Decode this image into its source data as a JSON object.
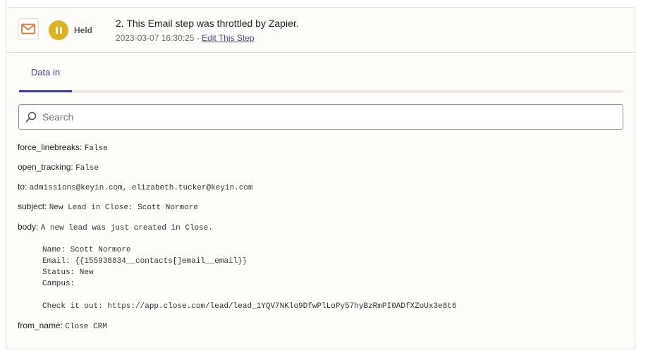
{
  "step": {
    "status_label": "Held",
    "title": "2. This Email step was throttled by Zapier.",
    "timestamp": "2023-03-07 16:30:25",
    "separator": " - ",
    "edit_link": "Edit This Step",
    "app_icon": "envelope-icon",
    "status_icon": "pause-icon"
  },
  "tabs": [
    {
      "label": "Data in",
      "active": true
    }
  ],
  "search": {
    "placeholder": "Search",
    "value": ""
  },
  "fields": {
    "force_linebreaks": {
      "key": "force_linebreaks:",
      "value": "False"
    },
    "open_tracking": {
      "key": "open_tracking:",
      "value": "False"
    },
    "to": {
      "key": "to:",
      "value": "admissions@keyin.com, elizabeth.tucker@keyin.com"
    },
    "subject": {
      "key": "subject:",
      "value": "New Lead in Close: Scott Normore"
    },
    "body": {
      "key": "body:",
      "value": "A new lead was just created in Close.",
      "lines": [
        "Name: Scott Normore",
        "Email: {{155938834__contacts[]email__email}}",
        "Status: New",
        "Campus:",
        "",
        "Check it out: https://app.close.com/lead/lead_1YQV7NKlo9DfwPlLoPy57hyBzRmPI0ADfXZoUx3e8t6"
      ]
    },
    "from_name": {
      "key": "from_name:",
      "value": "Close CRM"
    }
  },
  "colors": {
    "accent": "#3b3ea8",
    "held": "#e0b11a",
    "email_app": "#e8742c"
  }
}
